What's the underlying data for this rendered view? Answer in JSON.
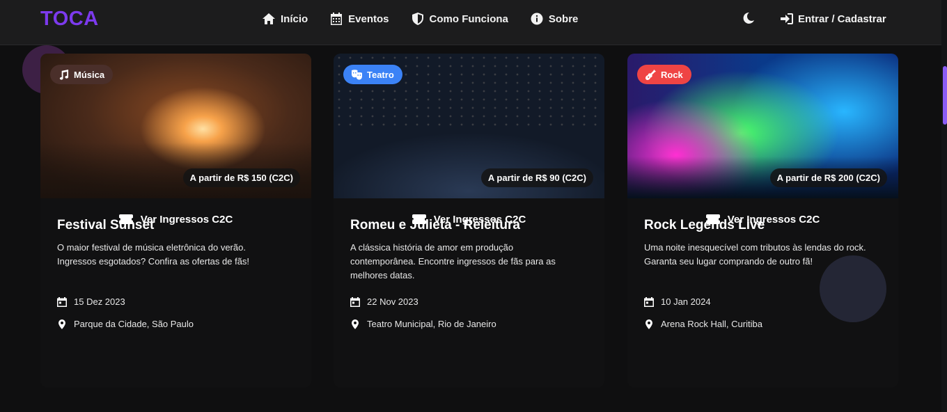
{
  "app": {
    "logo": "TOCA"
  },
  "nav": {
    "links": [
      {
        "label": "Início",
        "icon": "home-icon"
      },
      {
        "label": "Eventos",
        "icon": "calendar-icon"
      },
      {
        "label": "Como Funciona",
        "icon": "shield-icon"
      },
      {
        "label": "Sobre",
        "icon": "info-icon"
      }
    ],
    "theme_toggle_icon": "moon-icon",
    "login": {
      "label": "Entrar / Cadastrar",
      "icon": "sign-in-icon"
    }
  },
  "colors": {
    "brand": "#7c3aed",
    "badge_music": "#4a2f2a",
    "badge_theater": "#3b82f6",
    "badge_rock": "#ef4444"
  },
  "events": [
    {
      "category": "Música",
      "category_icon": "music-icon",
      "price": "A partir de R$ 150 (C2C)",
      "title": "Festival Sunset",
      "description": "O maior festival de música eletrônica do verão. Ingressos esgotados? Confira as ofertas de fãs!",
      "date": "15 Dez 2023",
      "location": "Parque da Cidade, São Paulo",
      "cta": "Ver Ingressos C2C"
    },
    {
      "category": "Teatro",
      "category_icon": "theater-masks-icon",
      "price": "A partir de R$ 90 (C2C)",
      "title": "Romeu e Julieta - Releitura",
      "description": "A clássica história de amor em produção contemporânea. Encontre ingressos de fãs para as melhores datas.",
      "date": "22 Nov 2023",
      "location": "Teatro Municipal, Rio de Janeiro",
      "cta": "Ver Ingressos C2C"
    },
    {
      "category": "Rock",
      "category_icon": "guitar-icon",
      "price": "A partir de R$ 200 (C2C)",
      "title": "Rock Legends Live",
      "description": "Uma noite inesquecível com tributos às lendas do rock. Garanta seu lugar comprando de outro fã!",
      "date": "10 Jan 2024",
      "location": "Arena Rock Hall, Curitiba",
      "cta": "Ver Ingressos C2C"
    }
  ]
}
